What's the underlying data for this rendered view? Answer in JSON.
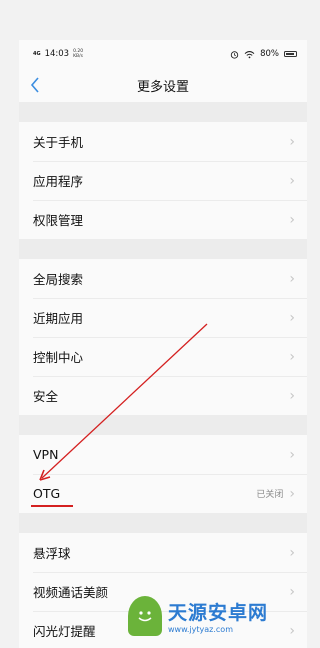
{
  "status_bar": {
    "signal": "4G",
    "time": "14:03",
    "speed_value": "0.20",
    "speed_unit": "KB/s",
    "battery": "80%",
    "alarm_icon": "alarm-icon",
    "wifi_icon": "wifi-icon",
    "battery_icon": "battery-icon"
  },
  "nav": {
    "back_icon": "chevron-left-icon",
    "title": "更多设置"
  },
  "groups": [
    {
      "items": [
        {
          "label": "关于手机"
        },
        {
          "label": "应用程序"
        },
        {
          "label": "权限管理"
        }
      ]
    },
    {
      "items": [
        {
          "label": "全局搜索"
        },
        {
          "label": "近期应用"
        },
        {
          "label": "控制中心"
        },
        {
          "label": "安全"
        }
      ]
    },
    {
      "items": [
        {
          "label": "VPN"
        },
        {
          "label": "OTG",
          "value": "已关闭"
        }
      ]
    },
    {
      "items": [
        {
          "label": "悬浮球"
        },
        {
          "label": "视频通话美颜"
        },
        {
          "label": "闪光灯提醒"
        }
      ]
    }
  ],
  "chevron_glyph": "›",
  "annotation": {
    "arrow_color": "#d42020"
  },
  "watermark": {
    "title": "天源安卓网",
    "url": "www.jytyaz.com"
  }
}
